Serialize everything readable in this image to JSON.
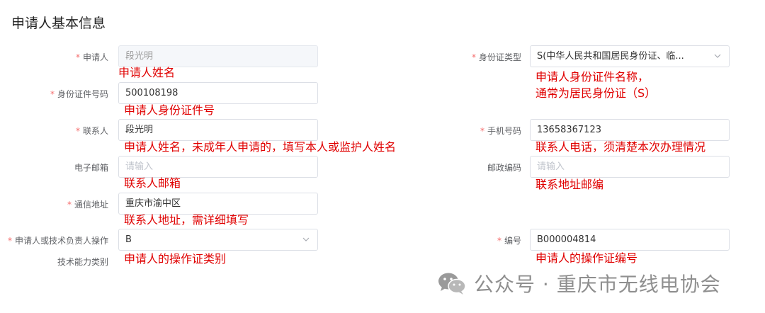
{
  "section_title": "申请人基本信息",
  "fields": {
    "applicant": {
      "label": "申请人",
      "value": "段光明",
      "note": "申请人姓名"
    },
    "id_type": {
      "label": "身份证类型",
      "value": "S(中华人民共和国居民身份证、临...",
      "note_line1": "申请人身份证件名称，",
      "note_line2": "通常为居民身份证（S）"
    },
    "id_number": {
      "label": "身份证件号码",
      "value": "500108198",
      "note": "申请人身份证件号"
    },
    "contact": {
      "label": "联系人",
      "value": "段光明",
      "note": "申请人姓名，未成年人申请的，填写本人或监护人姓名"
    },
    "mobile": {
      "label": "手机号码",
      "value": "13658367123",
      "note": "联系人电话，须清楚本次办理情况"
    },
    "email": {
      "label": "电子邮箱",
      "placeholder": "请输入",
      "note": "联系人邮箱"
    },
    "postcode": {
      "label": "邮政编码",
      "placeholder": "请输入",
      "note": "联系地址邮编"
    },
    "address": {
      "label": "通信地址",
      "value": "重庆市渝中区",
      "note": "联系人地址，需详细填写"
    },
    "operator_cert": {
      "label": "申请人或技术负责人操作",
      "label2": "技术能力类别",
      "value": "B",
      "note": "申请人的操作证类别"
    },
    "cert_number": {
      "label": "编号",
      "value": "B000004814",
      "note": "申请人的操作证编号"
    }
  },
  "required_mark": "*",
  "watermark": {
    "text": "公众号 · 重庆市无线电协会",
    "icon": "wechat-icon"
  },
  "colors": {
    "note": "#e00000",
    "required": "#f56c6c",
    "border": "#dcdfe6"
  }
}
